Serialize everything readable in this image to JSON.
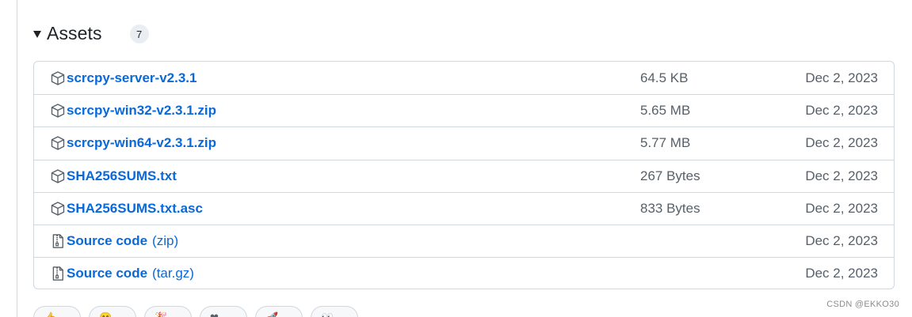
{
  "assets": {
    "title": "Assets",
    "count": "7",
    "rows": [
      {
        "name": "scrcpy-server-v2.3.1",
        "suffix": "",
        "size": "64.5 KB",
        "date": "Dec 2, 2023",
        "icon": "package-icon"
      },
      {
        "name": "scrcpy-win32-v2.3.1.zip",
        "suffix": "",
        "size": "5.65 MB",
        "date": "Dec 2, 2023",
        "icon": "package-icon"
      },
      {
        "name": "scrcpy-win64-v2.3.1.zip",
        "suffix": "",
        "size": "5.77 MB",
        "date": "Dec 2, 2023",
        "icon": "package-icon"
      },
      {
        "name": "SHA256SUMS.txt",
        "suffix": "",
        "size": "267 Bytes",
        "date": "Dec 2, 2023",
        "icon": "package-icon"
      },
      {
        "name": "SHA256SUMS.txt.asc",
        "suffix": "",
        "size": "833 Bytes",
        "date": "Dec 2, 2023",
        "icon": "package-icon"
      },
      {
        "name": "Source code",
        "suffix": "(zip)",
        "size": "",
        "date": "Dec 2, 2023",
        "icon": "file-zip-icon"
      },
      {
        "name": "Source code",
        "suffix": "(tar.gz)",
        "size": "",
        "date": "Dec 2, 2023",
        "icon": "file-zip-icon"
      }
    ]
  },
  "reactions": [
    {
      "icon": "thumbs-up-icon",
      "emoji": "👍"
    },
    {
      "icon": "laugh-icon",
      "emoji": "😄"
    },
    {
      "icon": "hooray-icon",
      "emoji": "🎉"
    },
    {
      "icon": "heart-icon",
      "emoji": "❤"
    },
    {
      "icon": "rocket-icon",
      "emoji": "🚀"
    },
    {
      "icon": "eyes-icon",
      "emoji": "👀"
    }
  ],
  "watermark": "CSDN @EKKO30",
  "colors": {
    "link": "#0969da",
    "muted": "#57606a",
    "border": "#d0d7de",
    "badge_bg": "#eaeef2"
  }
}
